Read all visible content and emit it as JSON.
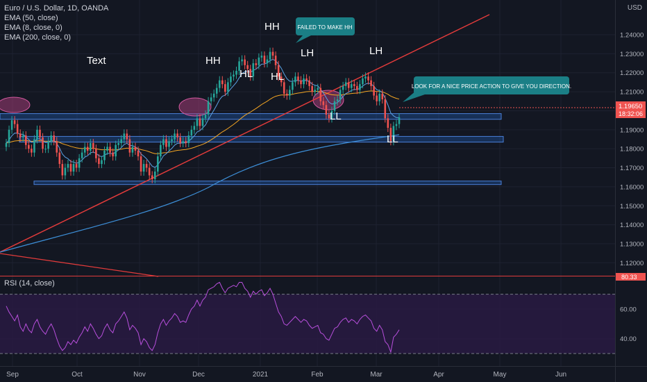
{
  "header": {
    "symbol_title": "Euro / U.S. Dollar, 1D, OANDA",
    "indicators": [
      "EMA (50, close)",
      "EMA (8, close, 0)",
      "EMA (200, close, 0)"
    ],
    "currency": "USD"
  },
  "rsi_pane": {
    "title": "RSI (14, close)",
    "badge": "80.33"
  },
  "price_label": {
    "price": "1.19650",
    "countdown": "18:32:06"
  },
  "colors": {
    "background": "#131722",
    "grid": "#1e2230",
    "up": "#26a69a",
    "down": "#ef5350",
    "ema8": "#5ca3e6",
    "ema50": "#f5a623",
    "ema200": "#3d8fd8",
    "trendline": "#e23b3b",
    "zone_fill": "#1c4f9a",
    "zone_stroke": "#4a7fd8",
    "highlight": "#a33d76",
    "callout": "#1b7f86",
    "rsi_line": "#b84fdc",
    "rsi_fill": "#2a1a45"
  },
  "chart_data": [
    {
      "type": "candlestick",
      "title": "Euro / U.S. Dollar, 1D, OANDA",
      "x_ticks": [
        "Sep",
        "Oct",
        "Nov",
        "Dec",
        "2021",
        "Feb",
        "Mar",
        "Apr",
        "May",
        "Jun"
      ],
      "y_ticks": [
        "1.12000",
        "1.13000",
        "1.14000",
        "1.15000",
        "1.16000",
        "1.17000",
        "1.18000",
        "1.19000",
        "1.20000",
        "1.21000",
        "1.22000",
        "1.23000",
        "1.24000"
      ],
      "ylim": [
        1.114,
        1.245
      ],
      "closes": [
        1.183,
        1.19,
        1.195,
        1.193,
        1.188,
        1.186,
        1.187,
        1.182,
        1.18,
        1.178,
        1.185,
        1.19,
        1.186,
        1.18,
        1.18,
        1.184,
        1.187,
        1.184,
        1.178,
        1.172,
        1.166,
        1.17,
        1.172,
        1.168,
        1.172,
        1.17,
        1.175,
        1.178,
        1.181,
        1.179,
        1.183,
        1.18,
        1.175,
        1.172,
        1.174,
        1.179,
        1.181,
        1.178,
        1.176,
        1.182,
        1.183,
        1.185,
        1.188,
        1.185,
        1.178,
        1.181,
        1.179,
        1.176,
        1.168,
        1.172,
        1.17,
        1.166,
        1.164,
        1.168,
        1.176,
        1.182,
        1.185,
        1.181,
        1.184,
        1.185,
        1.188,
        1.186,
        1.183,
        1.184,
        1.183,
        1.187,
        1.19,
        1.192,
        1.196,
        1.192,
        1.196,
        1.198,
        1.205,
        1.207,
        1.209,
        1.212,
        1.216,
        1.214,
        1.21,
        1.215,
        1.218,
        1.219,
        1.221,
        1.226,
        1.227,
        1.224,
        1.222,
        1.218,
        1.225,
        1.224,
        1.228,
        1.229,
        1.225,
        1.227,
        1.231,
        1.229,
        1.224,
        1.218,
        1.215,
        1.209,
        1.208,
        1.211,
        1.215,
        1.218,
        1.216,
        1.214,
        1.217,
        1.216,
        1.213,
        1.21,
        1.211,
        1.212,
        1.205,
        1.203,
        1.198,
        1.196,
        1.2,
        1.205,
        1.206,
        1.211,
        1.213,
        1.215,
        1.212,
        1.214,
        1.213,
        1.211,
        1.214,
        1.217,
        1.218,
        1.216,
        1.213,
        1.208,
        1.205,
        1.209,
        1.206,
        1.196,
        1.191,
        1.184,
        1.192,
        1.193,
        1.1965
      ],
      "series": [
        {
          "name": "EMA (50, close)"
        },
        {
          "name": "EMA (8, close, 0)"
        },
        {
          "name": "EMA (200, close, 0)"
        }
      ],
      "annotations": {
        "labels": [
          "HH",
          "HH",
          "HL",
          "HL",
          "LH",
          "LH",
          "LL",
          "LL"
        ],
        "side_text": "Text",
        "callouts": [
          "FAILED TO MAKE HH",
          "LOOK FOR A NICE PRICE ACTION TO GIVE YOU DIRECTION."
        ],
        "zones": [
          {
            "from": 1.1955,
            "to": 1.1985
          },
          {
            "from": 1.1835,
            "to": 1.1865
          },
          {
            "from": 1.1618,
            "to": 1.163
          }
        ]
      }
    },
    {
      "type": "line",
      "title": "RSI (14, close)",
      "y_ticks": [
        "40.00",
        "60.00"
      ],
      "ylim": [
        18,
        88
      ],
      "bands": [
        70,
        30
      ],
      "values": [
        62,
        58,
        55,
        52,
        56,
        48,
        45,
        50,
        46,
        44,
        50,
        53,
        48,
        45,
        43,
        47,
        50,
        46,
        40,
        35,
        32,
        34,
        38,
        36,
        39,
        37,
        41,
        44,
        48,
        45,
        50,
        47,
        43,
        40,
        42,
        47,
        50,
        46,
        44,
        50,
        52,
        55,
        58,
        54,
        46,
        49,
        47,
        44,
        36,
        40,
        38,
        34,
        32,
        36,
        44,
        50,
        53,
        49,
        52,
        54,
        57,
        55,
        51,
        52,
        51,
        56,
        60,
        62,
        66,
        62,
        66,
        68,
        73,
        74,
        75,
        77,
        78,
        74,
        71,
        74,
        75,
        76,
        75,
        78,
        78,
        74,
        72,
        68,
        72,
        70,
        72,
        73,
        69,
        71,
        74,
        70,
        64,
        58,
        55,
        50,
        49,
        51,
        53,
        55,
        53,
        51,
        53,
        52,
        49,
        47,
        48,
        49,
        44,
        43,
        40,
        39,
        43,
        47,
        48,
        51,
        53,
        54,
        51,
        53,
        52,
        50,
        53,
        55,
        56,
        54,
        52,
        47,
        45,
        49,
        46,
        38,
        36,
        31,
        41,
        43,
        46
      ]
    }
  ]
}
